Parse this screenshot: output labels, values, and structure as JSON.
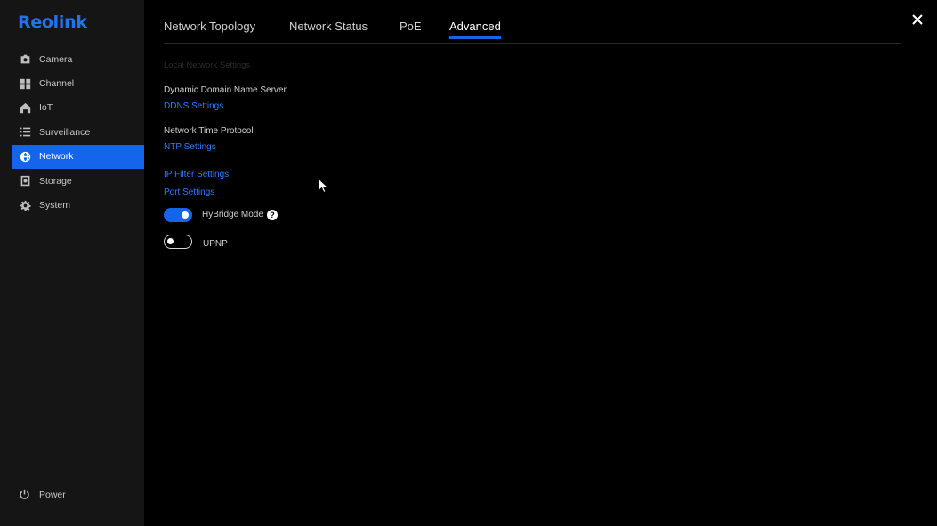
{
  "brand": {
    "logo_text": "Reolink",
    "accent": "#1565ec"
  },
  "sidebar": {
    "items": [
      {
        "label": "Camera",
        "icon": "camera-icon"
      },
      {
        "label": "Channel",
        "icon": "grid-icon"
      },
      {
        "label": "IoT",
        "icon": "home-icon"
      },
      {
        "label": "Surveillance",
        "icon": "list-icon"
      },
      {
        "label": "Network",
        "icon": "globe-icon",
        "active": true
      },
      {
        "label": "Storage",
        "icon": "storage-icon"
      },
      {
        "label": "System",
        "icon": "gear-icon"
      }
    ],
    "power_label": "Power"
  },
  "tabs": [
    {
      "label": "Network Topology"
    },
    {
      "label": "Network Status"
    },
    {
      "label": "PoE"
    },
    {
      "label": "Advanced",
      "active": true
    }
  ],
  "content": {
    "faded_header": "Local Network Settings",
    "ddns": {
      "label": "Dynamic Domain Name Server",
      "link": "DDNS Settings"
    },
    "ntp": {
      "label": "Network Time Protocol",
      "link": "NTP Settings"
    },
    "ip_filter_link": "IP Filter Settings",
    "port_link": "Port Settings",
    "hybridge": {
      "label": "HyBridge Mode",
      "enabled": true,
      "help_glyph": "?"
    },
    "upnp": {
      "label": "UPNP",
      "enabled": false
    }
  }
}
